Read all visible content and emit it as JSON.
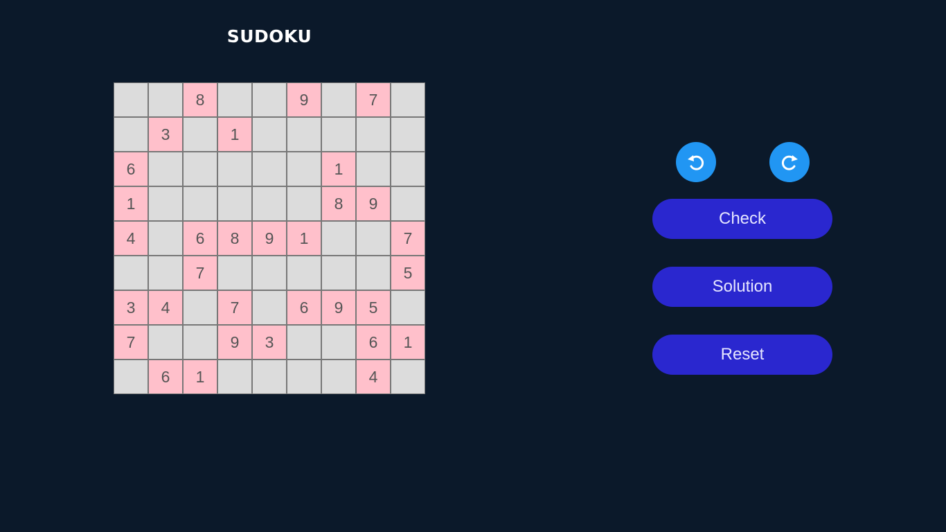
{
  "title": "SUDOKU",
  "board": [
    [
      "",
      "",
      "8",
      "",
      "",
      "9",
      "",
      "7",
      ""
    ],
    [
      "",
      "3",
      "",
      "1",
      "",
      "",
      "",
      "",
      ""
    ],
    [
      "6",
      "",
      "",
      "",
      "",
      "",
      "1",
      "",
      ""
    ],
    [
      "1",
      "",
      "",
      "",
      "",
      "",
      "8",
      "9",
      ""
    ],
    [
      "4",
      "",
      "6",
      "8",
      "9",
      "1",
      "",
      "",
      "7"
    ],
    [
      "",
      "",
      "7",
      "",
      "",
      "",
      "",
      "",
      "5"
    ],
    [
      "3",
      "4",
      "",
      "7",
      "",
      "6",
      "9",
      "5",
      ""
    ],
    [
      "7",
      "",
      "",
      "9",
      "3",
      "",
      "",
      "6",
      "1"
    ],
    [
      "",
      "6",
      "1",
      "",
      "",
      "",
      "",
      "4",
      ""
    ]
  ],
  "controls": {
    "undo_icon": "undo-icon",
    "redo_icon": "redo-icon",
    "check_label": "Check",
    "solution_label": "Solution",
    "reset_label": "Reset"
  },
  "colors": {
    "background": "#0b192a",
    "given_cell": "#ffc0cb",
    "empty_cell": "#dcdcdc",
    "icon_button": "#2196f3",
    "action_button": "#2a27cf"
  }
}
